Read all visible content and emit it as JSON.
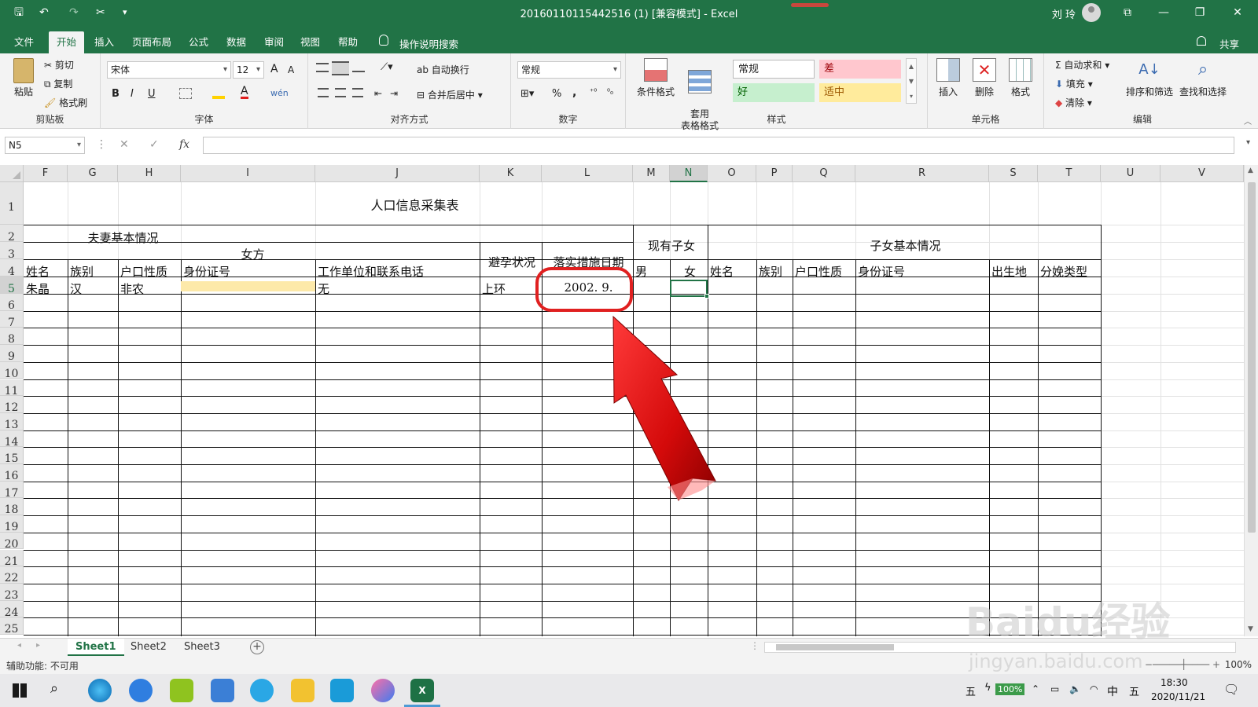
{
  "window": {
    "title": "20160110115442516 (1) [兼容模式] - Excel",
    "user": "刘 玲",
    "qa": {
      "save": "🖫",
      "undo": "↶",
      "redo": "↷",
      "cut": "✂",
      "more": "▾"
    },
    "controls": {
      "ribbon_display": "⧉",
      "minimize": "—",
      "restore": "❐",
      "close": "✕"
    }
  },
  "menu": {
    "tabs": [
      "文件",
      "开始",
      "插入",
      "页面布局",
      "公式",
      "数据",
      "审阅",
      "视图",
      "帮助"
    ],
    "active_index": 1,
    "search_hint": "操作说明搜索",
    "share": "共享"
  },
  "ribbon": {
    "clipboard": {
      "label": "剪贴板",
      "paste": "粘贴",
      "cut": "剪切",
      "copy": "复制",
      "format_painter": "格式刷"
    },
    "font": {
      "label": "字体",
      "font_name": "宋体",
      "font_size": "12",
      "bold": "B",
      "italic": "I",
      "underline": "U",
      "grow": "A",
      "shrink": "A",
      "font_color": "A",
      "phonetic": "wén"
    },
    "alignment": {
      "label": "对齐方式",
      "wrap": "自动换行",
      "merge": "合并后居中"
    },
    "number": {
      "label": "数字",
      "format": "常规",
      "percent": "%",
      "comma": ","
    },
    "styles": {
      "label": "样式",
      "conditional": "条件格式",
      "table_format": "套用\n表格格式",
      "cell_styles": [
        {
          "name": "常规",
          "bg": "#ffffff",
          "fg": "#222222"
        },
        {
          "name": "差",
          "bg": "#ffc7ce",
          "fg": "#9c0006"
        },
        {
          "name": "好",
          "bg": "#c6efce",
          "fg": "#006100"
        },
        {
          "name": "适中",
          "bg": "#ffeb9c",
          "fg": "#9c5700"
        }
      ]
    },
    "cells": {
      "label": "单元格",
      "insert": "插入",
      "delete": "删除",
      "format": "格式"
    },
    "editing": {
      "label": "编辑",
      "autosum": "自动求和",
      "fill": "填充",
      "clear": "清除",
      "sort": "排序和筛选",
      "find": "查找和选择"
    }
  },
  "formula_bar": {
    "name_box": "N5",
    "cancel": "✕",
    "enter": "✓",
    "fx": "fx",
    "content": ""
  },
  "grid": {
    "columns": [
      "F",
      "G",
      "H",
      "I",
      "J",
      "K",
      "L",
      "M",
      "N",
      "O",
      "P",
      "Q",
      "R",
      "S",
      "T",
      "U",
      "V"
    ],
    "selected_column": "N",
    "rows": [
      "1",
      "2",
      "3",
      "4",
      "5",
      "6",
      "7",
      "8",
      "9",
      "10",
      "11",
      "12",
      "13",
      "14",
      "15",
      "16",
      "17",
      "18",
      "19",
      "20",
      "21",
      "22",
      "23",
      "24",
      "25"
    ],
    "selected_row": "5",
    "cells": {
      "title": "人口信息采集表",
      "couple_info": "夫妻基本情况",
      "female": "女方",
      "contraception": "避孕状况",
      "measure_date": "落实措施日期",
      "current_children": "现有子女",
      "child_info": "子女基本情况",
      "h_name": "姓名",
      "h_ethnic": "族别",
      "h_hukou": "户口性质",
      "h_id": "身份证号",
      "h_work": "工作单位和联系电话",
      "h_male": "男",
      "h_female": "女",
      "h_cname": "姓名",
      "h_cethnic": "族别",
      "h_chukou": "户口性质",
      "h_cid": "身份证号",
      "h_birthplace": "出生地",
      "h_delivery": "分娩类型",
      "r5_name": "朱晶",
      "r5_ethnic": "汉",
      "r5_hukou": "非农",
      "r5_work": "无",
      "r5_contra": "上环",
      "r5_date": "2002. 9."
    },
    "highlight_color": "#fde9a9"
  },
  "sheets": {
    "tabs": [
      "Sheet1",
      "Sheet2",
      "Sheet3"
    ],
    "active_index": 0,
    "add": "+"
  },
  "status": {
    "accessibility": "辅助功能: 不可用",
    "zoom": "100%"
  },
  "taskbar": {
    "ime1": "五",
    "battery": "100%",
    "lang": "中",
    "ime2": "五",
    "time": "18:30",
    "date": "2020/11/21"
  },
  "watermark": {
    "brand": "Baidu经验",
    "url": "jingyan.baidu.com"
  },
  "annotation_color": "#e02020"
}
